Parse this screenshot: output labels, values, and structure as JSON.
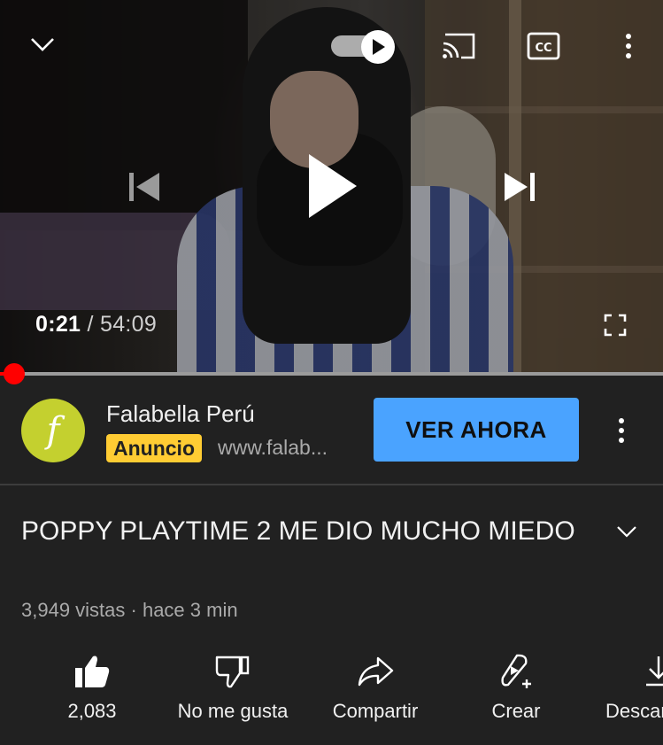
{
  "player": {
    "current_time": "0:21",
    "separator": "/",
    "duration": "54:09",
    "progress_fraction": 0.0065,
    "icons": [
      "chevron-down-icon",
      "autoplay-toggle-icon",
      "cast-icon",
      "closed-captions-icon",
      "more-vertical-icon",
      "skip-previous-icon",
      "play-icon",
      "skip-next-icon",
      "fullscreen-icon"
    ],
    "autoplay_on": true
  },
  "ad": {
    "advertiser": "Falabella Perú",
    "logo_letter": "f",
    "badge": "Anuncio",
    "url": "www.falab...",
    "cta": "VER AHORA",
    "colors": {
      "logo_bg": "#c4d02f",
      "badge_bg": "#ffcc33",
      "cta_bg": "#4aa3ff"
    }
  },
  "video": {
    "title": "POPPY PLAYTIME 2 ME DIO MUCHO MIEDO",
    "meta": "3,949 vistas · hace 3 min"
  },
  "actions": {
    "like": "2,083",
    "dislike": "No me gusta",
    "share": "Compartir",
    "create": "Crear",
    "download": "Descargar"
  },
  "colors": {
    "background": "#212121",
    "progress": "#ff0000",
    "text": "#f1f1f1",
    "muted": "#aaaaaa"
  }
}
